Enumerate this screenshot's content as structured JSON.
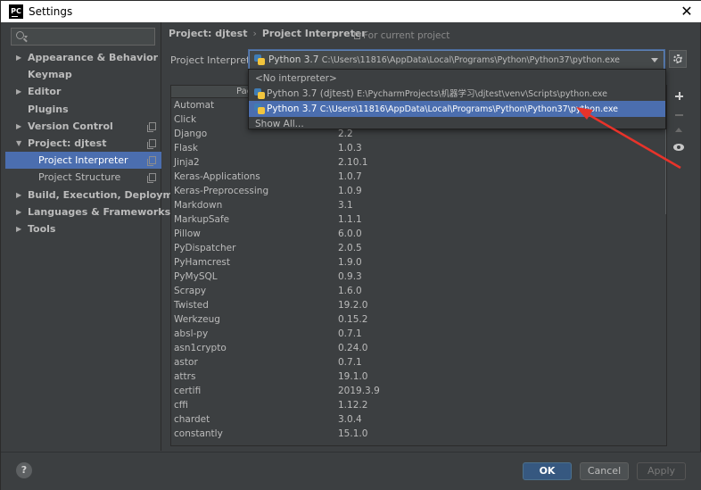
{
  "window": {
    "title": "Settings",
    "logo_text": "PC"
  },
  "sidebar": {
    "items": [
      {
        "label": "Appearance & Behavior",
        "arrow": "▶",
        "bold": true,
        "child": false,
        "copy": false,
        "selected": false
      },
      {
        "label": "Keymap",
        "arrow": "",
        "bold": true,
        "child": false,
        "copy": false,
        "selected": false
      },
      {
        "label": "Editor",
        "arrow": "▶",
        "bold": true,
        "child": false,
        "copy": false,
        "selected": false
      },
      {
        "label": "Plugins",
        "arrow": "",
        "bold": true,
        "child": false,
        "copy": false,
        "selected": false
      },
      {
        "label": "Version Control",
        "arrow": "▶",
        "bold": true,
        "child": false,
        "copy": true,
        "selected": false
      },
      {
        "label": "Project: djtest",
        "arrow": "▼",
        "bold": true,
        "child": false,
        "copy": true,
        "selected": false
      },
      {
        "label": "Project Interpreter",
        "arrow": "",
        "bold": false,
        "child": true,
        "copy": true,
        "selected": true
      },
      {
        "label": "Project Structure",
        "arrow": "",
        "bold": false,
        "child": true,
        "copy": true,
        "selected": false
      },
      {
        "label": "Build, Execution, Deployment",
        "arrow": "▶",
        "bold": true,
        "child": false,
        "copy": false,
        "selected": false
      },
      {
        "label": "Languages & Frameworks",
        "arrow": "▶",
        "bold": true,
        "child": false,
        "copy": false,
        "selected": false
      },
      {
        "label": "Tools",
        "arrow": "▶",
        "bold": true,
        "child": false,
        "copy": false,
        "selected": false
      }
    ]
  },
  "header": {
    "breadcrumb_project": "Project: djtest",
    "breadcrumb_separator": "›",
    "breadcrumb_page": "Project Interpreter",
    "for_current_project": "For current project"
  },
  "interpreter": {
    "label": "Project Interpreter:",
    "selected_name": "Python 3.7",
    "selected_path": "C:\\Users\\11816\\AppData\\Local\\Programs\\Python\\Python37\\python.exe"
  },
  "popup": {
    "options": [
      {
        "name": "<No interpreter>",
        "path": "",
        "icon": false,
        "selected": false
      },
      {
        "name": "Python 3.7 (djtest)",
        "path": "E:\\PycharmProjects\\机器学习\\djtest\\venv\\Scripts\\python.exe",
        "icon": true,
        "selected": false
      },
      {
        "name": "Python 3.7",
        "path": "C:\\Users\\11816\\AppData\\Local\\Programs\\Python\\Python37\\python.exe",
        "icon": true,
        "selected": true
      },
      {
        "name": "Show All...",
        "path": "",
        "icon": false,
        "selected": false
      }
    ]
  },
  "packages": {
    "header_visible_text": "Pac",
    "rows": [
      {
        "name": "Automat",
        "version": ""
      },
      {
        "name": "Click",
        "version": ""
      },
      {
        "name": "Django",
        "version": "2.2"
      },
      {
        "name": "Flask",
        "version": "1.0.3"
      },
      {
        "name": "Jinja2",
        "version": "2.10.1"
      },
      {
        "name": "Keras-Applications",
        "version": "1.0.7"
      },
      {
        "name": "Keras-Preprocessing",
        "version": "1.0.9"
      },
      {
        "name": "Markdown",
        "version": "3.1"
      },
      {
        "name": "MarkupSafe",
        "version": "1.1.1"
      },
      {
        "name": "Pillow",
        "version": "6.0.0"
      },
      {
        "name": "PyDispatcher",
        "version": "2.0.5"
      },
      {
        "name": "PyHamcrest",
        "version": "1.9.0"
      },
      {
        "name": "PyMySQL",
        "version": "0.9.3"
      },
      {
        "name": "Scrapy",
        "version": "1.6.0"
      },
      {
        "name": "Twisted",
        "version": "19.2.0"
      },
      {
        "name": "Werkzeug",
        "version": "0.15.2"
      },
      {
        "name": "absl-py",
        "version": "0.7.1"
      },
      {
        "name": "asn1crypto",
        "version": "0.24.0"
      },
      {
        "name": "astor",
        "version": "0.7.1"
      },
      {
        "name": "attrs",
        "version": "19.1.0"
      },
      {
        "name": "certifi",
        "version": "2019.3.9"
      },
      {
        "name": "cffi",
        "version": "1.12.2"
      },
      {
        "name": "chardet",
        "version": "3.0.4"
      },
      {
        "name": "constantly",
        "version": "15.1.0"
      }
    ]
  },
  "buttons": {
    "ok": "OK",
    "cancel": "Cancel",
    "apply": "Apply",
    "help": "?"
  },
  "colors": {
    "accent": "#4b6eaf",
    "annotation_arrow": "#e8332a",
    "ok_button": "#365880"
  }
}
